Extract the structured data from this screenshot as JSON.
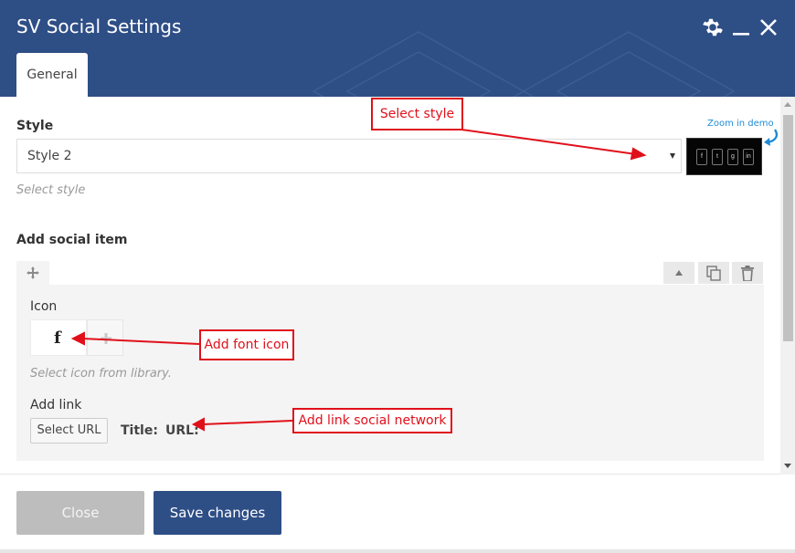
{
  "window": {
    "title": "SV Social Settings",
    "icons": [
      "gear-icon",
      "minimize-icon",
      "close-icon"
    ]
  },
  "tabs": [
    {
      "label": "General",
      "active": true
    }
  ],
  "style_field": {
    "label": "Style",
    "value": "Style 2",
    "hint": "Select style",
    "zoom_link": "Zoom in demo"
  },
  "social_item": {
    "section_label": "Add social item",
    "icon_label": "Icon",
    "icon_hint": "Select icon from library.",
    "link_label": "Add link",
    "select_url_button": "Select URL",
    "title_label": "Title:",
    "url_label": "URL:",
    "preview_glyphs": [
      "f",
      "t",
      "g",
      "in"
    ]
  },
  "annotations": {
    "style": "Select style",
    "icon": "Add font icon",
    "link": "Add link social network"
  },
  "footer": {
    "close_button": "Close",
    "save_button": "Save changes"
  },
  "colors": {
    "header": "#2e4e86",
    "annotation": "#e0101a",
    "link": "#1e8bd6"
  }
}
